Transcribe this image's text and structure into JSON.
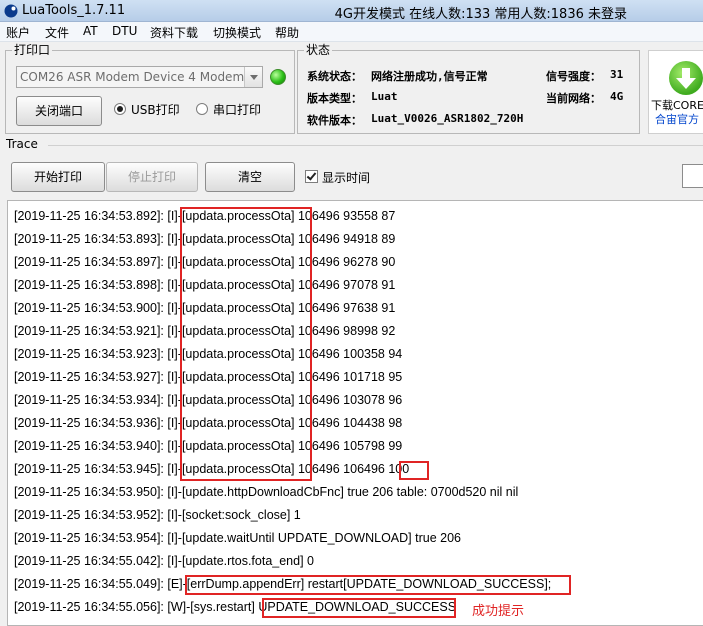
{
  "window": {
    "title": "LuaTools_1.7.11",
    "mode_text": "4G开发模式 在线人数:133 常用人数:1836 未登录"
  },
  "menu": [
    "账户",
    "文件",
    "AT",
    "DTU",
    "资料下载",
    "切换模式",
    "帮助"
  ],
  "print_port": {
    "group_title": "打印口",
    "port_value": "COM26 ASR Modem Device 4 Modem",
    "close_port_label": "关闭端口",
    "usb_print_label": "USB打印",
    "serial_print_label": "串口打印",
    "selected_mode": "USB打印",
    "status_color": "#2bbf17"
  },
  "status": {
    "group_title": "状态",
    "system_status_label": "系统状态：",
    "system_status_value": "网络注册成功,信号正常",
    "signal_label": "信号强度：",
    "signal_value": "31",
    "version_type_label": "版本类型：",
    "version_type_value": "Luat",
    "network_label": "当前网络：",
    "network_value": "4G",
    "firmware_label": "软件版本：",
    "firmware_value": "Luat_V0026_ASR1802_720H"
  },
  "download": {
    "label": "下载CORE(.",
    "link": "合宙官方"
  },
  "trace": {
    "title": "Trace",
    "start_print_label": "开始打印",
    "stop_print_label": "停止打印",
    "clear_label": "清空",
    "show_time_label": "显示时间",
    "show_time_checked": true
  },
  "log_lines": [
    "[2019-11-25 16:34:53.892]: [I]-[updata.processOta] 106496 93558 87",
    "[2019-11-25 16:34:53.893]: [I]-[updata.processOta] 106496 94918 89",
    "[2019-11-25 16:34:53.897]: [I]-[updata.processOta] 106496 96278 90",
    "[2019-11-25 16:34:53.898]: [I]-[updata.processOta] 106496 97078 91",
    "[2019-11-25 16:34:53.900]: [I]-[updata.processOta] 106496 97638 91",
    "[2019-11-25 16:34:53.921]: [I]-[updata.processOta] 106496 98998 92",
    "[2019-11-25 16:34:53.923]: [I]-[updata.processOta] 106496 100358 94",
    "[2019-11-25 16:34:53.927]: [I]-[updata.processOta] 106496 101718 95",
    "[2019-11-25 16:34:53.934]: [I]-[updata.processOta] 106496 103078 96",
    "[2019-11-25 16:34:53.936]: [I]-[updata.processOta] 106496 104438 98",
    "[2019-11-25 16:34:53.940]: [I]-[updata.processOta] 106496 105798 99",
    "[2019-11-25 16:34:53.945]: [I]-[updata.processOta] 106496 106496 100",
    "[2019-11-25 16:34:53.950]: [I]-[update.httpDownloadCbFnc] true 206 table: 0700d520 nil nil",
    "[2019-11-25 16:34:53.952]: [I]-[socket:sock_close] 1",
    "[2019-11-25 16:34:53.954]: [I]-[update.waitUntil UPDATE_DOWNLOAD] true 206",
    "[2019-11-25 16:34:55.042]: [I]-[update.rtos.fota_end] 0",
    "[2019-11-25 16:34:55.049]: [E]-[errDump.appendErr] restart[UPDATE_DOWNLOAD_SUCCESS];",
    "[2019-11-25 16:34:55.056]: [W]-[sys.restart] UPDATE_DOWNLOAD_SUCCESS"
  ],
  "annotation": {
    "note": "成功提示",
    "color": "#e02424"
  }
}
